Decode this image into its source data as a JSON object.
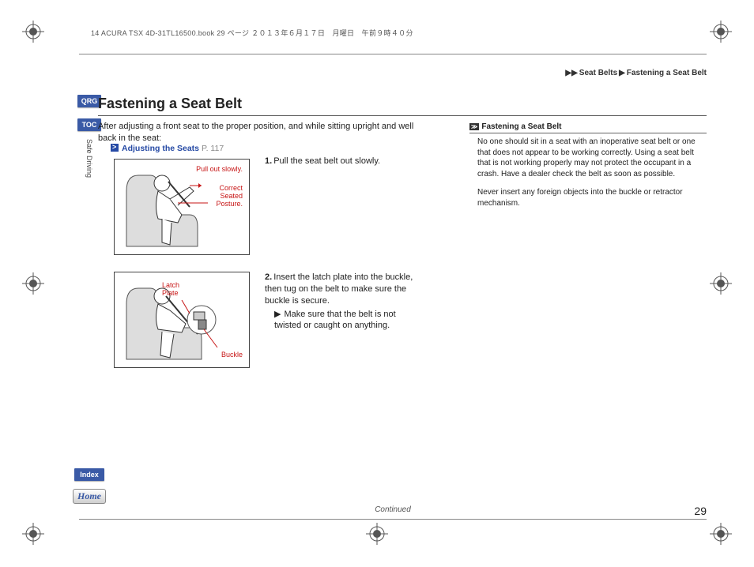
{
  "header": {
    "file_info": "14 ACURA TSX 4D-31TL16500.book  29 ページ  ２０１３年６月１７日　月曜日　午前９時４０分"
  },
  "breadcrumb": {
    "a": "Seat Belts",
    "b": "Fastening a Seat Belt"
  },
  "title": "Fastening a Seat Belt",
  "intro": "After adjusting a front seat to the proper position, and while sitting upright and well back in the seat:",
  "link": {
    "text": "Adjusting the Seats",
    "page": "P. 117"
  },
  "panel1": {
    "l1": "Pull out slowly.",
    "l2": "Correct\nSeated\nPosture."
  },
  "panel2": {
    "l1": "Latch\nPlate",
    "l2": "Buckle"
  },
  "steps": {
    "s1_num": "1.",
    "s1": "Pull the seat belt out slowly.",
    "s2_num": "2.",
    "s2": "Insert the latch plate into the buckle, then tug on the belt to make sure the buckle is secure.",
    "s2_sub": "Make sure that the belt is not twisted or caught on anything."
  },
  "side": {
    "head": "Fastening a Seat Belt",
    "p1": "No one should sit in a seat with an inoperative seat belt or one that does not appear to be working correctly. Using a seat belt that is not working properly may not protect the occupant in a crash. Have a dealer check the belt as soon as possible.",
    "p2": "Never insert any foreign objects into the buckle or retractor mechanism."
  },
  "continued": "Continued",
  "page_number": "29",
  "nav": {
    "qrg": "QRG",
    "toc": "TOC",
    "section": "Safe Driving",
    "index": "Index",
    "home": "Home"
  }
}
